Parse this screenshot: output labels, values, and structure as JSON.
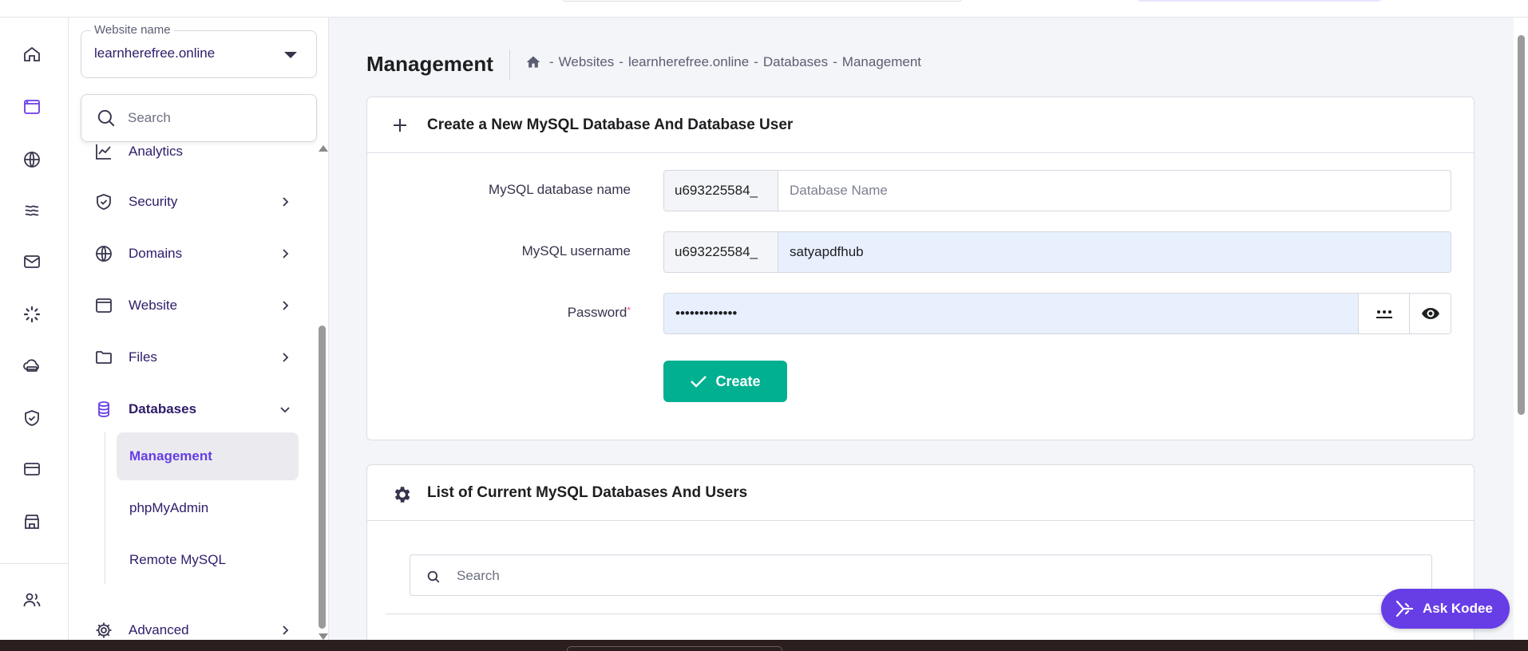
{
  "sidebar": {
    "website_select": {
      "label": "Website name",
      "value": "learnherefree.online"
    },
    "search": {
      "placeholder": "Search"
    },
    "items": [
      {
        "label": "Analytics",
        "icon": "analytics-icon"
      },
      {
        "label": "Security",
        "icon": "shield-icon"
      },
      {
        "label": "Domains",
        "icon": "globe-icon"
      },
      {
        "label": "Website",
        "icon": "browser-window-icon"
      },
      {
        "label": "Files",
        "icon": "folder-icon"
      },
      {
        "label": "Databases",
        "icon": "database-icon",
        "expanded": true
      },
      {
        "label": "Advanced",
        "icon": "gear-icon"
      }
    ],
    "sub_items": [
      {
        "label": "Management",
        "active": true
      },
      {
        "label": "phpMyAdmin"
      },
      {
        "label": "Remote MySQL"
      }
    ]
  },
  "header": {
    "title": "Management",
    "breadcrumb": [
      "Websites",
      "learnherefree.online",
      "Databases",
      "Management"
    ],
    "separator": "-"
  },
  "create_card": {
    "title": "Create a New MySQL Database And Database User",
    "db_name": {
      "label": "MySQL database name",
      "prefix": "u693225584_",
      "placeholder": "Database Name",
      "value": ""
    },
    "username": {
      "label": "MySQL username",
      "prefix": "u693225584_",
      "value": "satyapdfhub"
    },
    "password": {
      "label": "Password",
      "required_mark": "*",
      "value": "satyapdfhub12"
    },
    "create_button": "Create"
  },
  "list_card": {
    "title": "List of Current MySQL Databases And Users",
    "search_placeholder": "Search"
  },
  "assistant_button": "Ask Kodee",
  "colors": {
    "accent": "#673de6",
    "success": "#00b090",
    "text": "#2f1c6a"
  }
}
